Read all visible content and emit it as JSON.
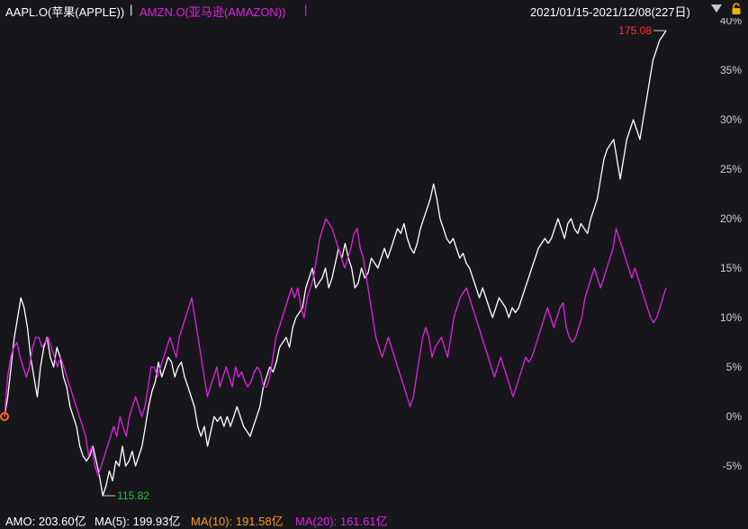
{
  "header": {
    "series1_label": "AAPL.O(苹果(APPLE))",
    "sep1": "|",
    "series2_label": "AMZN.O(亚马逊(AMAZON))",
    "sep2": "|",
    "range": "2021/01/15-2021/12/08(227日)"
  },
  "footer": {
    "amo": "AMO: 203.60亿",
    "ma5": "MA(5): 199.93亿",
    "ma10": "MA(10): 191.58亿",
    "ma20": "MA(20): 161.61亿"
  },
  "colors": {
    "background": "#17171b",
    "apple": "#ffffff",
    "amazon": "#e022e0",
    "max_label": "#ff3030",
    "min_label": "#20c040",
    "ma10": "#ff9a1e"
  },
  "icons": [
    "dropdown-icon",
    "lock-icon",
    "start-marker-icon"
  ],
  "chart_data": {
    "type": "line",
    "x_range": [
      "2021/01/15",
      "2021/12/08"
    ],
    "x_count": 227,
    "ylim": [
      -9,
      40
    ],
    "y_ticks": [
      "40%",
      "35%",
      "30%",
      "25%",
      "20%",
      "15%",
      "10%",
      "5%",
      "0%",
      "-5%"
    ],
    "y_tick_values": [
      40,
      35,
      30,
      25,
      20,
      15,
      10,
      5,
      0,
      -5
    ],
    "grid": false,
    "annotations": {
      "max": {
        "series": "AAPL.O(苹果(APPLE))",
        "label": "175.08"
      },
      "min": {
        "series": "AAPL.O(苹果(APPLE))",
        "label": "115.82"
      }
    },
    "series": [
      {
        "name": "AAPL.O(苹果(APPLE))",
        "values": [
          0,
          2,
          5,
          8,
          10,
          12,
          11,
          9,
          6,
          4,
          2,
          5,
          7,
          8,
          6,
          5,
          7,
          6,
          4,
          3,
          1,
          0,
          -1,
          -3,
          -4,
          -4.5,
          -4,
          -3,
          -4.5,
          -6,
          -8,
          -7,
          -5.5,
          -6.5,
          -4.5,
          -5,
          -3,
          -5,
          -4.5,
          -3.5,
          -5,
          -4,
          -3,
          -1,
          1,
          2.5,
          3.5,
          5.5,
          4,
          5,
          6,
          5.5,
          4,
          5,
          5.5,
          4,
          3,
          2,
          1,
          -1,
          -2,
          -1,
          -3,
          -1.5,
          0,
          -0.5,
          0,
          -1,
          0,
          -1,
          0,
          1,
          0,
          -1,
          -1.5,
          -2,
          -1,
          0,
          1,
          3,
          4,
          5,
          4.5,
          5.5,
          7,
          7.5,
          8,
          7,
          9,
          10,
          10.5,
          11,
          13,
          14,
          15,
          13,
          13.5,
          14,
          15,
          13,
          14,
          15.5,
          17,
          16,
          17.5,
          16,
          15,
          13,
          13.5,
          15,
          14,
          14.5,
          16,
          15.5,
          15,
          16,
          17,
          16,
          17,
          18,
          19,
          18.5,
          19.5,
          18,
          17,
          16.5,
          17.5,
          19,
          20,
          21,
          22,
          23.5,
          22,
          20,
          19,
          18,
          17.5,
          18,
          17,
          16,
          16.5,
          15.5,
          15,
          14,
          13,
          12,
          13,
          12,
          11,
          10,
          11,
          12,
          11.5,
          11,
          10,
          11,
          10.5,
          11,
          12,
          13,
          14,
          15,
          16,
          17,
          17.5,
          18,
          17.5,
          18,
          19,
          20,
          19,
          18,
          19.5,
          20,
          19,
          18.5,
          19.5,
          19,
          18.5,
          20,
          21,
          22,
          24,
          26,
          27,
          27.5,
          28,
          26,
          24,
          26,
          28,
          29,
          30,
          29,
          28,
          30,
          32,
          34,
          36,
          37,
          38,
          38.5,
          39
        ],
        "max_label": "175.08",
        "min_label": "115.82"
      },
      {
        "name": "AMZN.O(亚马逊(AMAZON))",
        "values": [
          0,
          4,
          6,
          7,
          7.5,
          6,
          5,
          4,
          5,
          7,
          8,
          8,
          7,
          7.5,
          8,
          7,
          6,
          5,
          6,
          5,
          4,
          3,
          2,
          1,
          0,
          -1,
          -2,
          -4,
          -3,
          -5,
          -6,
          -5,
          -4,
          -3,
          -2,
          -1,
          -2,
          0,
          -1,
          -2,
          0,
          1,
          2,
          1,
          0,
          1,
          3,
          5,
          5,
          4,
          5,
          6,
          7,
          8,
          7,
          6,
          8,
          9,
          10,
          11,
          12,
          10,
          8,
          6,
          4,
          2,
          3,
          4,
          5,
          3,
          4,
          5,
          4,
          3,
          5,
          4,
          4.5,
          3.5,
          3,
          3.5,
          4.5,
          5,
          4.5,
          3,
          3,
          4,
          6,
          8,
          9,
          10,
          11,
          12,
          13,
          12,
          13,
          11,
          10,
          12,
          13,
          14,
          16,
          18,
          19,
          20,
          19.5,
          19,
          18,
          17,
          16,
          15,
          16,
          17,
          18.5,
          19,
          17,
          16,
          14,
          12,
          10,
          8,
          7,
          6,
          7,
          8,
          7,
          6,
          5,
          4,
          3,
          2,
          1,
          2,
          4,
          6,
          8,
          9,
          8,
          6,
          7,
          7.5,
          8,
          7,
          6,
          8,
          10,
          11,
          12,
          12.5,
          13,
          12,
          11,
          10,
          9,
          8,
          7,
          6,
          5,
          4,
          5,
          6,
          5,
          4,
          3,
          2,
          3,
          4,
          5,
          6,
          5.5,
          6,
          7,
          8,
          9,
          10,
          11,
          10,
          9,
          10,
          11,
          11.5,
          9,
          8,
          7.5,
          8,
          9,
          10,
          12,
          13,
          14,
          15,
          14,
          13,
          14,
          15,
          16,
          17,
          19,
          18,
          17,
          16,
          15,
          14,
          15,
          14,
          13,
          12,
          11,
          10,
          9.5,
          10,
          11,
          12,
          13
        ]
      }
    ]
  }
}
